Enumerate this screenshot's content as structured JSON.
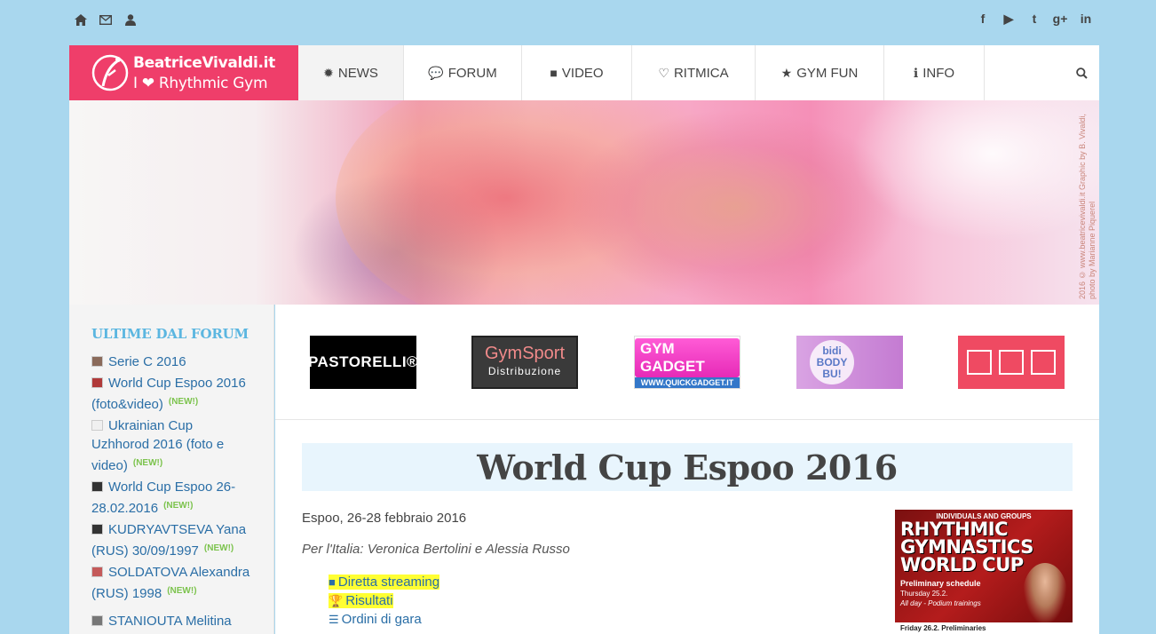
{
  "topbar": {
    "left_icons": [
      "home-icon",
      "envelope-icon",
      "user-icon"
    ],
    "social": [
      "f",
      "▶",
      "t",
      "g+",
      "in"
    ]
  },
  "logo": {
    "line1": "BeatriceVivaldi.it",
    "line2_pre": "I",
    "line2_post": "Rhythmic Gym"
  },
  "nav": {
    "items": [
      {
        "label": "NEWS",
        "icon": "✹"
      },
      {
        "label": "FORUM",
        "icon": "💬"
      },
      {
        "label": "VIDEO",
        "icon": "■"
      },
      {
        "label": "RITMICA",
        "icon": "♡"
      },
      {
        "label": "GYM FUN",
        "icon": "★"
      },
      {
        "label": "INFO",
        "icon": "ℹ"
      }
    ],
    "search_icon": "⚲"
  },
  "banner": {
    "credit": "2016 © www.beatricevivaldi.it Graphic by B. Vivaldi, photo by Marianne Piquerel"
  },
  "sidebar": {
    "title": "ULTIME DAL FORUM",
    "new_tag": "(NEW!)",
    "items": [
      {
        "text": "Serie C 2016",
        "new": ""
      },
      {
        "text": "World Cup Espoo 2016 (foto&video)",
        "new": "(NEW!)"
      },
      {
        "text": "Ukrainian Cup Uzhhorod 2016 (foto e video)",
        "new": "(NEW!)"
      },
      {
        "text": "World Cup Espoo 26-28.02.2016",
        "new": "(NEW!)"
      },
      {
        "text": "KUDRYAVTSEVA Yana (RUS) 30/09/1997",
        "new": "(NEW!)"
      },
      {
        "text": "SOLDATOVA Alexandra (RUS) 1998",
        "new": "(NEW!)"
      },
      {
        "text": "STANIOUTA Melitina",
        "new": ""
      }
    ]
  },
  "sponsors": {
    "s1": "PASTORELLI®",
    "s2_main": "GymSport",
    "s2_sub": "Distribuzione",
    "s3_main": "GYM GADGET",
    "s3_sub": "WWW.QUICKGADGET.IT",
    "s4_a": "bidi",
    "s4_b": "BODY",
    "s4_c": "BU!"
  },
  "article": {
    "title": "World Cup Espoo 2016",
    "date": "Espoo, 26-28 febbraio 2016",
    "italy": "Per l'Italia: Veronica Bertolini e Alessia Russo",
    "links": [
      {
        "label": "Diretta streaming",
        "icon": "■",
        "highlight": true
      },
      {
        "label": "Risultati",
        "icon": "🏆",
        "highlight": true
      },
      {
        "label": "Ordini di gara",
        "icon": "☰",
        "highlight": false
      }
    ]
  },
  "poster": {
    "top": "INDIVIDUALS AND GROUPS",
    "l1": "RHYTHMIC",
    "l2": "GYMNASTICS",
    "l3": "WORLD CUP",
    "sched": "Preliminary schedule",
    "day1": "Thursday 25.2.",
    "day1b": "All day - Podium trainings",
    "day2": "Friday 26.2. Preliminaries"
  },
  "colors": {
    "accent": "#ef3e6a",
    "sidebar_title": "#5bb6e0",
    "link": "#2a6ea6",
    "new": "#7cc34d",
    "highlight": "#ffff33"
  }
}
